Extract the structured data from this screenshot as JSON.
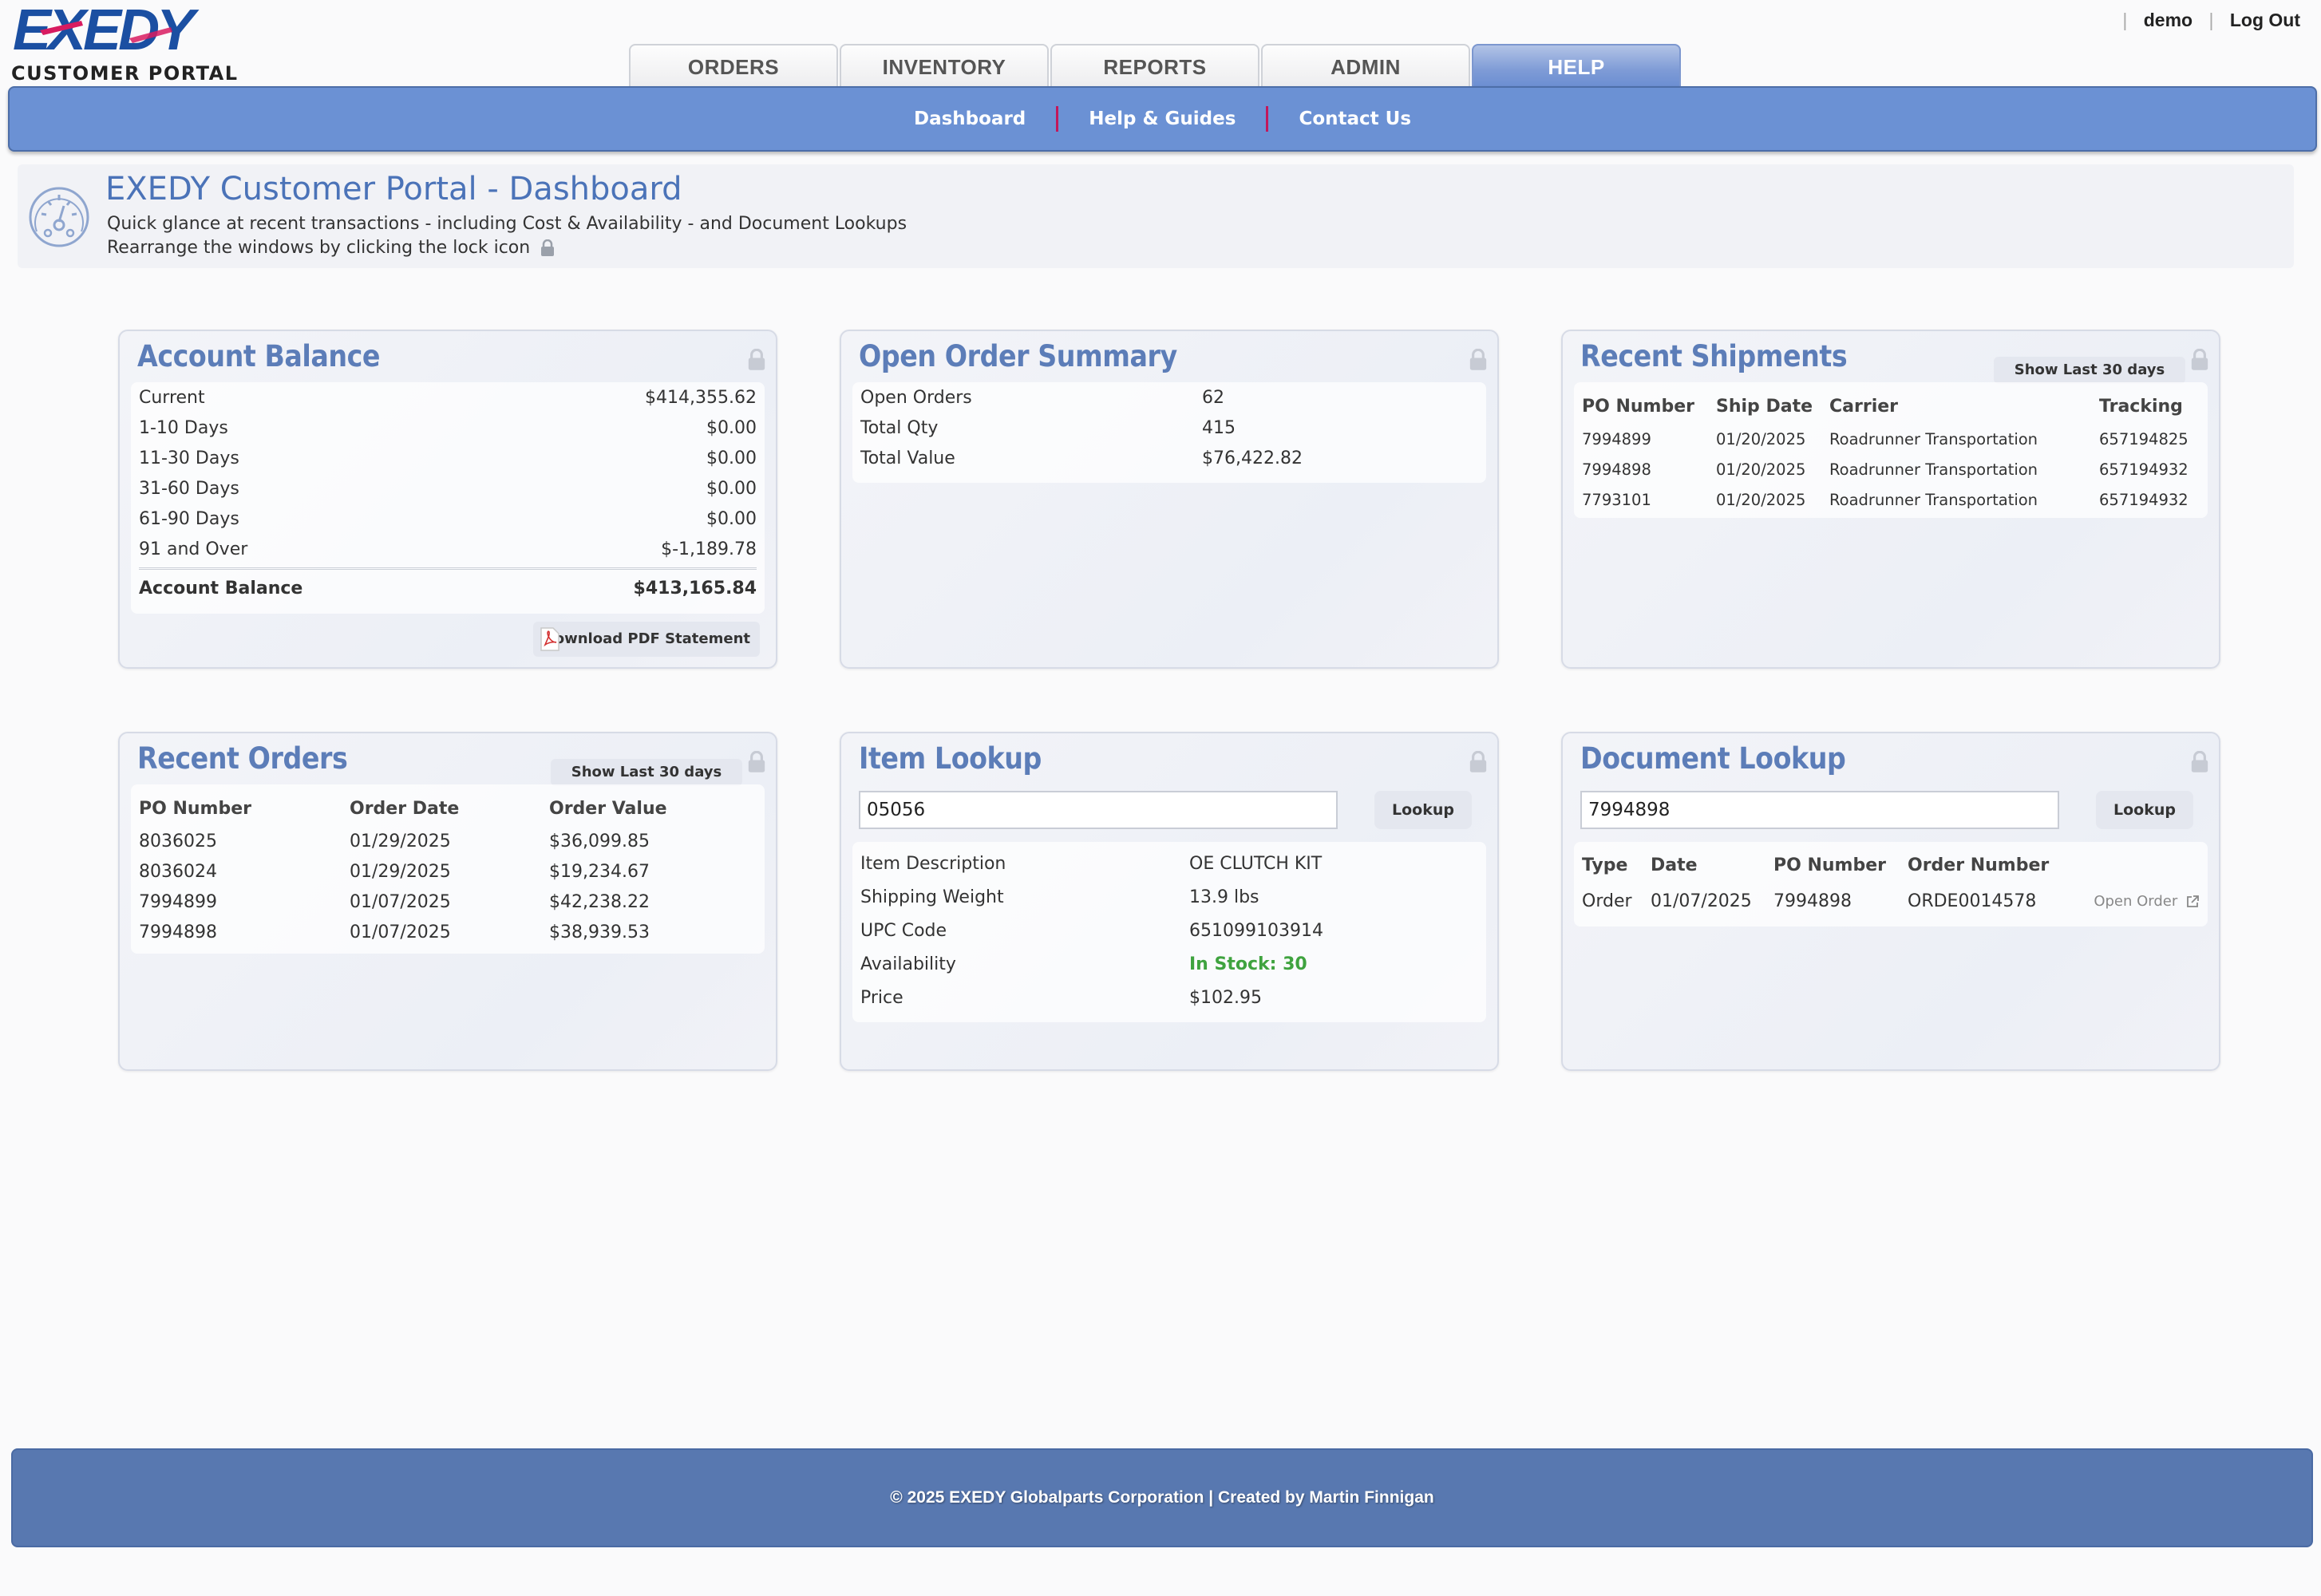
{
  "brand": {
    "logo_text": "EXEDY",
    "logo_subtitle": "CUSTOMER PORTAL"
  },
  "user_links": {
    "username": "demo",
    "logout": "Log Out",
    "separator": "|"
  },
  "tabs": [
    {
      "label": "ORDERS"
    },
    {
      "label": "INVENTORY"
    },
    {
      "label": "REPORTS"
    },
    {
      "label": "ADMIN"
    },
    {
      "label": "HELP",
      "active": true
    }
  ],
  "subnav": {
    "items": [
      "Dashboard",
      "Help & Guides",
      "Contact Us"
    ]
  },
  "banner": {
    "title": "EXEDY Customer Portal - Dashboard",
    "line1": "Quick glance at recent transactions - including Cost & Availability - and Document Lookups",
    "line2": "Rearrange the windows by clicking the lock icon"
  },
  "account_balance": {
    "title": "Account Balance",
    "rows": [
      {
        "label": "Current",
        "value": "$414,355.62"
      },
      {
        "label": "1-10 Days",
        "value": "$0.00"
      },
      {
        "label": "11-30 Days",
        "value": "$0.00"
      },
      {
        "label": "31-60 Days",
        "value": "$0.00"
      },
      {
        "label": "61-90 Days",
        "value": "$0.00"
      },
      {
        "label": "91 and Over",
        "value": "$-1,189.78"
      }
    ],
    "total_label": "Account Balance",
    "total_value": "$413,165.84",
    "download_label": "Download PDF Statement"
  },
  "open_order_summary": {
    "title": "Open Order Summary",
    "rows": [
      {
        "label": "Open Orders",
        "value": "62"
      },
      {
        "label": "Total Qty",
        "value": "415"
      },
      {
        "label": "Total Value",
        "value": "$76,422.82"
      }
    ]
  },
  "recent_shipments": {
    "title": "Recent Shipments",
    "filter_label": "Show Last 30 days",
    "columns": [
      "PO Number",
      "Ship Date",
      "Carrier",
      "Tracking"
    ],
    "rows": [
      [
        "7994899",
        "01/20/2025",
        "Roadrunner Transportation",
        "657194825"
      ],
      [
        "7994898",
        "01/20/2025",
        "Roadrunner Transportation",
        "657194932"
      ],
      [
        "7793101",
        "01/20/2025",
        "Roadrunner Transportation",
        "657194932"
      ]
    ]
  },
  "recent_orders": {
    "title": "Recent Orders",
    "filter_label": "Show Last 30 days",
    "columns": [
      "PO Number",
      "Order Date",
      "Order Value"
    ],
    "rows": [
      [
        "8036025",
        "01/29/2025",
        "$36,099.85"
      ],
      [
        "8036024",
        "01/29/2025",
        "$19,234.67"
      ],
      [
        "7994899",
        "01/07/2025",
        "$42,238.22"
      ],
      [
        "7994898",
        "01/07/2025",
        "$38,939.53"
      ]
    ]
  },
  "item_lookup": {
    "title": "Item Lookup",
    "input_value": "05056",
    "button_label": "Lookup",
    "rows": [
      {
        "label": "Item Description",
        "value": "OE CLUTCH KIT"
      },
      {
        "label": "Shipping Weight",
        "value": "13.9 lbs"
      },
      {
        "label": "UPC Code",
        "value": "651099103914"
      },
      {
        "label": "Availability",
        "value": "In Stock: 30"
      },
      {
        "label": "Price",
        "value": "$102.95"
      }
    ],
    "availability_color": "#3fa33f"
  },
  "document_lookup": {
    "title": "Document Lookup",
    "input_value": "7994898",
    "button_label": "Lookup",
    "columns": [
      "Type",
      "Date",
      "PO Number",
      "Order Number"
    ],
    "rows": [
      {
        "type": "Order",
        "date": "01/07/2025",
        "po": "7994898",
        "order": "ORDE0014578",
        "action": "Open Order"
      }
    ]
  },
  "footer": {
    "text": "© 2025 EXEDY Globalparts Corporation | Created by Martin Finnigan"
  },
  "colors": {
    "accent": "#6b91d4",
    "title_blue": "#5c7db8",
    "brand_blue": "#1a4fa0",
    "divider": "#c2185b",
    "footer": "#5878b0"
  },
  "icons": [
    "dashboard-gauge-icon",
    "lock-icon",
    "pdf-icon",
    "external-link-icon"
  ]
}
